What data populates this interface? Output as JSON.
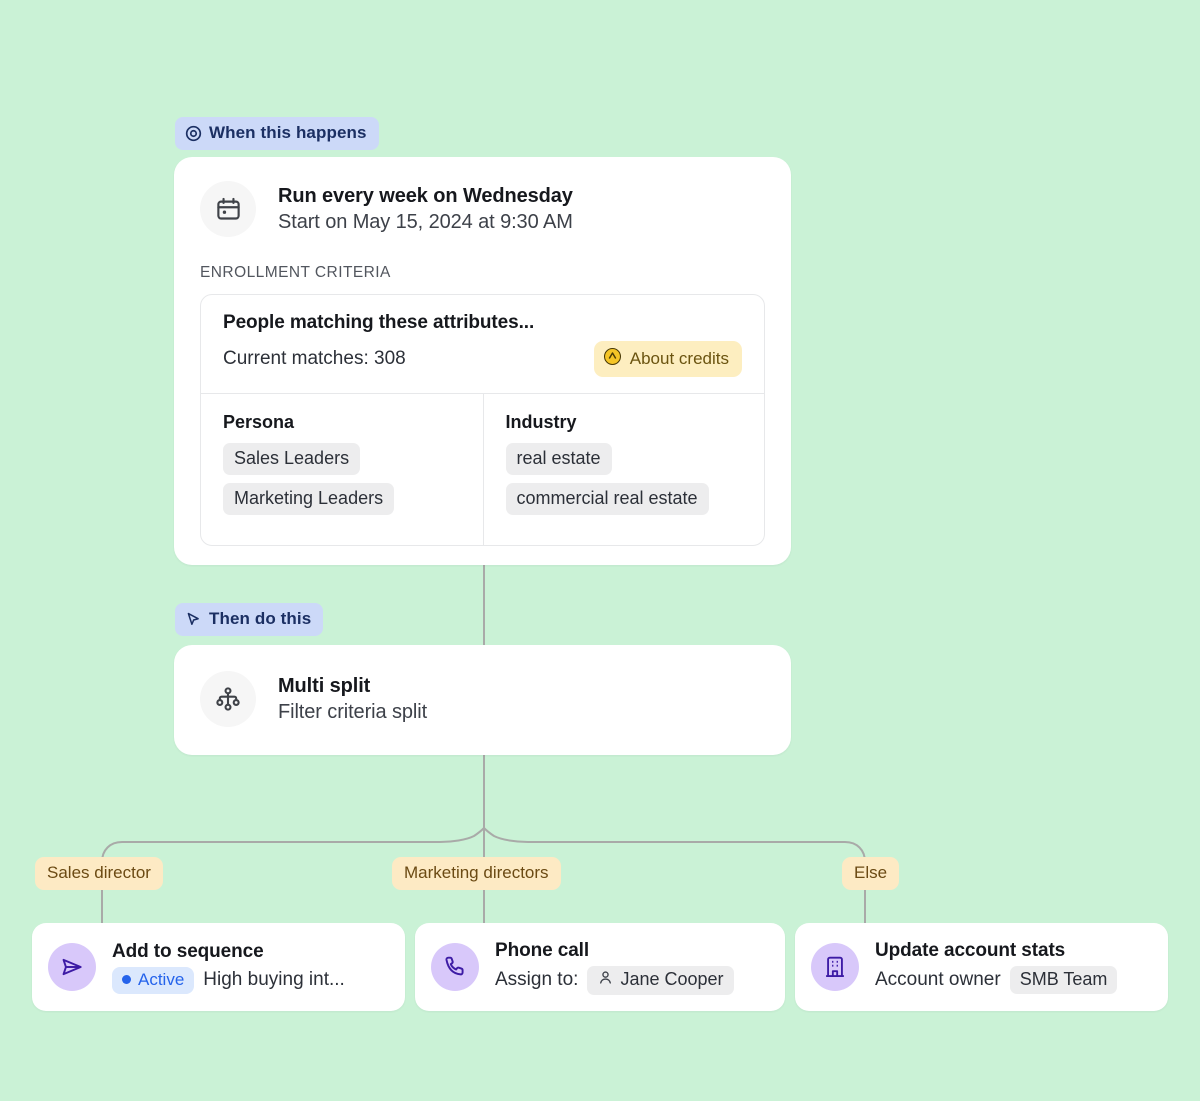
{
  "theme": {
    "canvas_bg": "#caf2d6",
    "card_bg": "#ffffff",
    "badge_bg": "#ccd9f8",
    "badge_text": "#1b2f63",
    "branch_bg": "#fdeac4",
    "branch_text": "#6b4a13",
    "credits_bg": "#fdeec0",
    "credits_text": "#6b5410",
    "action_icon_bg": "#d8c8fa",
    "action_icon_stroke": "#3d1ba5",
    "status_accent": "#2563eb",
    "tag_bg": "#ededee",
    "wire": "#a9aaa8"
  },
  "trigger": {
    "badge": {
      "label": "When this happens",
      "icon": "target-icon"
    },
    "icon": "calendar-icon",
    "title": "Run every week on Wednesday",
    "subtitle": "Start on May 15, 2024 at 9:30 AM",
    "section_label": "ENROLLMENT CRITERIA",
    "criteria": {
      "title": "People matching these attributes...",
      "matches_text": "Current matches: 308",
      "credits_pill": {
        "label": "About credits",
        "icon": "credits-icon"
      },
      "columns": [
        {
          "title": "Persona",
          "tags": [
            "Sales Leaders",
            "Marketing Leaders"
          ]
        },
        {
          "title": "Industry",
          "tags": [
            "real estate",
            "commercial real estate"
          ]
        }
      ]
    }
  },
  "action_section": {
    "badge": {
      "label": "Then do this",
      "icon": "cursor-icon"
    },
    "split": {
      "icon": "multi-split-icon",
      "title": "Multi split",
      "subtitle": "Filter criteria split"
    }
  },
  "branches": [
    {
      "label": "Sales director",
      "icon": "send-icon",
      "title": "Add to sequence",
      "status": {
        "label": "Active"
      },
      "detail": "High buying int..."
    },
    {
      "label": "Marketing directors",
      "icon": "phone-icon",
      "title": "Phone call",
      "detail_prefix": "Assign to:",
      "chip": {
        "label": "Jane Cooper",
        "icon": "user-icon"
      }
    },
    {
      "label": "Else",
      "icon": "building-icon",
      "title": "Update account stats",
      "detail_prefix": "Account owner",
      "chip": {
        "label": "SMB Team"
      }
    }
  ]
}
